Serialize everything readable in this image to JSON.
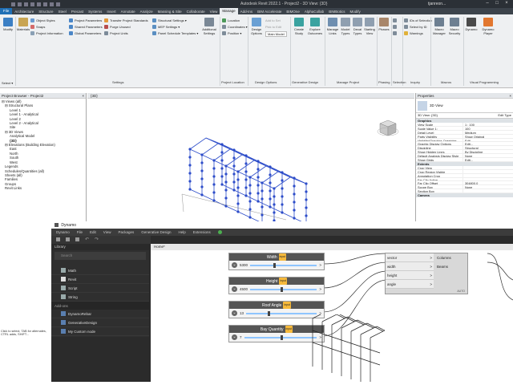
{
  "app": {
    "title": "Autodesk Revit 2022.1 - Project2 - 3D View: {3D}",
    "user": "tjanreon...",
    "select_label": "Select ▾"
  },
  "ribbon_tabs": [
    "File",
    "Architecture",
    "Structure",
    "Steel",
    "Precast",
    "Systems",
    "Insert",
    "Annotate",
    "Analyze",
    "Massing & Site",
    "Collaborate",
    "View",
    "Manage",
    "Add-Ins",
    "BIM Accelerate",
    "BIMOne",
    "AlphaCollab",
    "BIMBotics",
    "Modify"
  ],
  "ribbon_active": "Manage",
  "ribbon": {
    "modify": "Modify",
    "materials": "Materials",
    "object_styles": "Object Styles",
    "snaps": "Snaps",
    "project_information": "Project Information",
    "project_parameters": "Project Parameters",
    "shared_parameters": "Shared Parameters",
    "global_parameters": "Global Parameters",
    "transfer_project_standards": "Transfer Project Standards",
    "purge_unused": "Purge Unused",
    "project_units": "Project Units",
    "structural_settings": "Structural Settings ▾",
    "mep_settings": "MEP Settings ▾",
    "panel_schedule_templates": "Panel Schedule Templates ▾",
    "additional_settings": "Additional Settings",
    "location": "Location",
    "coordinates": "Coordinates ▾",
    "position": "Position ▾",
    "design_options": "Design Options",
    "main_model": "Main Model",
    "add_to_set": "Add to Set",
    "pick_to_edit": "Pick to Edit",
    "create_study": "Create Study",
    "explore_outcomes": "Explore Outcomes",
    "manage_links": "Manage Links",
    "model_types": "Model Types",
    "decal_types": "Decal Types",
    "starting_view": "Starting View",
    "phases": "Phases",
    "select_by_id": "Select by ID",
    "ids_of_selection": "IDs of Selection",
    "warnings": "Warnings",
    "macro_manager": "Macro Manager",
    "macro_security": "Macro Security",
    "dynamo": "Dynamo",
    "dynamo_player": "Dynamo Player",
    "groups": {
      "select": "Select ▾",
      "settings": "Settings",
      "project_location": "Project Location",
      "design_options": "Design Options",
      "generative_design": "Generative Design",
      "manage_project": "Manage Project",
      "phasing": "Phasing",
      "selection": "Selection",
      "inquiry": "Inquiry",
      "macros": "Macros",
      "visual_programming": "Visual Programming"
    }
  },
  "project_browser": {
    "title": "Project Browser - Project2",
    "items": [
      "⊟ Views (all)",
      "⊟ Structural Plans",
      "Level 1",
      "Level 1 - Analytical",
      "Level 2",
      "Level 2 - Analytical",
      "Site",
      "⊟ 3D Views",
      "Analytical Model",
      "{3D}",
      "⊟ Elevations (Building Elevation)",
      "East",
      "North",
      "South",
      "West",
      "Legends",
      "Schedules/Quantities (all)",
      "Sheets (all)",
      "Families",
      "Groups",
      "Revit Links"
    ]
  },
  "view": {
    "tab": "{3D}",
    "close": "×",
    "cube": "FRONT"
  },
  "properties": {
    "title": "Properties",
    "close": "×",
    "type": "3D View",
    "selector": "3D View: {3D}",
    "edit_type": "Edit Type",
    "sections": [
      {
        "name": "Graphics",
        "rows": [
          [
            "View Scale",
            "1 : 100"
          ],
          [
            "Scale Value    1:",
            "100"
          ],
          [
            "Detail Level",
            "Medium"
          ],
          [
            "Parts Visibility",
            "Show Original"
          ],
          [
            "Visibility/Graphics Overrides",
            "Edit..."
          ],
          [
            "Graphic Display Options",
            "Edit..."
          ],
          [
            "Discipline",
            "Structural"
          ],
          [
            "Show Hidden Lines",
            "By Discipline"
          ],
          [
            "Default Analysis Display Style",
            "None"
          ],
          [
            "Show Grids",
            "Edit..."
          ]
        ]
      },
      {
        "name": "Extents",
        "rows": [
          [
            "Crop View",
            ""
          ],
          [
            "Crop Region Visible",
            ""
          ],
          [
            "Annotation Crop",
            ""
          ],
          [
            "Far Clip Active",
            ""
          ],
          [
            "Far Clip Offset",
            "304800.0"
          ],
          [
            "Scope Box",
            "None"
          ],
          [
            "Section Box",
            ""
          ]
        ]
      },
      {
        "name": "Camera",
        "rows": []
      }
    ]
  },
  "dynamo": {
    "title": "Dynamo",
    "menus": [
      "Dynamo",
      "File",
      "Edit",
      "View",
      "Packages",
      "Generative Design",
      "Help",
      "Extensions"
    ],
    "library_label": "Library",
    "search_placeholder": "Search",
    "workspace_tab": "Home*",
    "library_items": [
      {
        "label": "Math",
        "icon": "math-icon"
      },
      {
        "label": "Revit",
        "icon": "revit-icon"
      },
      {
        "label": "Script",
        "icon": "script-icon"
      },
      {
        "label": "String",
        "icon": "string-icon"
      }
    ],
    "addons_label": "Add-ons",
    "addon_items": [
      "DynamoRebar",
      "GenerativeDesign",
      "My Custom node"
    ],
    "nodes": [
      {
        "title": "Width",
        "value": "5300",
        "badge": "input",
        "slider": 0.35
      },
      {
        "title": "Height",
        "value": "4500",
        "badge": "input",
        "slider": 0.45
      },
      {
        "title": "Roof Angle",
        "value": "13",
        "badge": "input",
        "slider": 0.3
      },
      {
        "title": "Bay Quantity",
        "value": "7",
        "badge": "input",
        "slider": 0.5
      }
    ],
    "custom_node": {
      "inputs": [
        "vector",
        "width",
        "height",
        "angle"
      ],
      "outputs": [
        "Columns",
        "Beams"
      ],
      "footer": "AUTO"
    }
  },
  "status": "Click to select, TAB for alternates, CTRL adds, SHIFT..."
}
